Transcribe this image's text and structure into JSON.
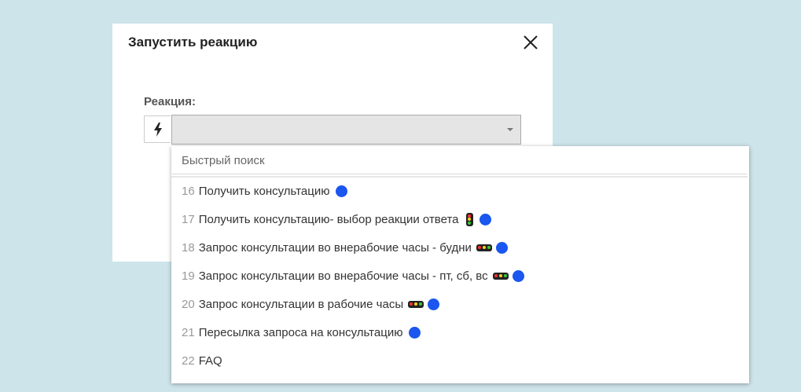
{
  "dialog": {
    "title": "Запустить реакцию",
    "close_icon": "close-icon"
  },
  "field": {
    "label": "Реакция:",
    "icon": "lightning-icon",
    "selected_value": ""
  },
  "dropdown": {
    "search_placeholder": "Быстрый поиск",
    "options": [
      {
        "number": "16",
        "label": "Получить консультацию",
        "icons": [
          "blue-dot-icon"
        ]
      },
      {
        "number": "17",
        "label": "Получить консультацию- выбор реакции ответа",
        "icons": [
          "vertical-traffic-light-icon",
          "blue-dot-icon"
        ]
      },
      {
        "number": "18",
        "label": "Запрос консультации во внерабочие часы - будни",
        "icons": [
          "horizontal-traffic-light-icon",
          "blue-dot-icon"
        ]
      },
      {
        "number": "19",
        "label": "Запрос консультации во внерабочие часы - пт, сб, вс",
        "icons": [
          "horizontal-traffic-light-icon",
          "blue-dot-icon"
        ]
      },
      {
        "number": "20",
        "label": "Запрос консультации в рабочие часы",
        "icons": [
          "horizontal-traffic-light-icon",
          "blue-dot-icon"
        ]
      },
      {
        "number": "21",
        "label": "Пересылка запроса на консультацию",
        "icons": [
          "blue-dot-icon"
        ]
      },
      {
        "number": "22",
        "label": "FAQ",
        "icons": []
      }
    ]
  },
  "colors": {
    "background": "#cde4ea",
    "dot_blue": "#1a56ef",
    "light_red": "#ff3030",
    "light_yellow": "#ffd21c",
    "light_green": "#33cc33"
  }
}
